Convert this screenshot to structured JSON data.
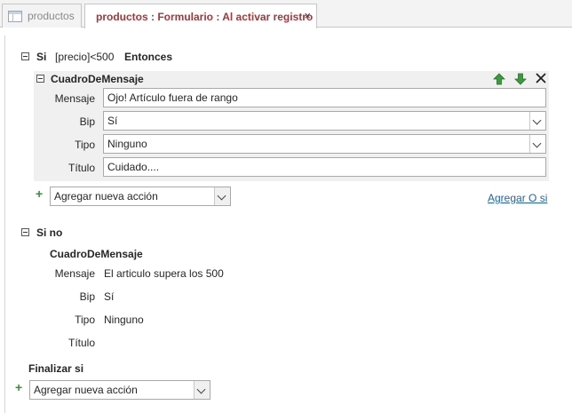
{
  "tabs": {
    "inactive_label": "productos",
    "active_label": "productos : Formulario : Al activar registro",
    "close_glyph": "×"
  },
  "if_block": {
    "keyword": "Si",
    "condition": "[precio]<500",
    "then_keyword": "Entonces",
    "action_name": "CuadroDeMensaje",
    "fields": {
      "mensaje_label": "Mensaje",
      "mensaje_value": "Ojo! Artículo fuera de rango",
      "bip_label": "Bip",
      "bip_value": "Sí",
      "tipo_label": "Tipo",
      "tipo_value": "Ninguno",
      "titulo_label": "Título",
      "titulo_value": "Cuidado...."
    },
    "add_action_placeholder": "Agregar nueva acción",
    "add_else_if_link": "Agregar O si"
  },
  "else_block": {
    "keyword": "Si no",
    "action_name": "CuadroDeMensaje",
    "fields": {
      "mensaje_label": "Mensaje",
      "mensaje_value": "El articulo supera los 500",
      "bip_label": "Bip",
      "bip_value": "Sí",
      "tipo_label": "Tipo",
      "tipo_value": "Ninguno",
      "titulo_label": "Título",
      "titulo_value": ""
    }
  },
  "end_if_label": "Finalizar si",
  "bottom_add_action_placeholder": "Agregar nueva acción",
  "icons": {
    "move_up": "move-up-arrow-icon",
    "move_down": "move-down-arrow-icon",
    "delete": "delete-x-icon",
    "add": "plus-icon"
  },
  "colors": {
    "active_tab_text": "#a4373a",
    "link": "#1f63b3",
    "plus_green": "#3f8d3f",
    "arrow_green": "#3c9b3c"
  }
}
